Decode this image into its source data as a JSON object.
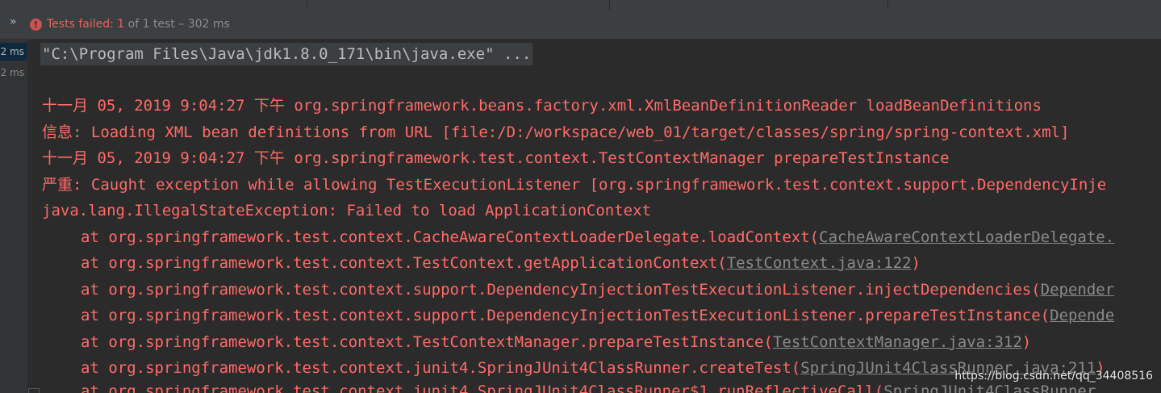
{
  "status": {
    "chevron_icon": "»",
    "error_icon": "!",
    "failed_label": "Tests failed:",
    "failed_count": "1",
    "rest_text": "of 1 test – 302 ms"
  },
  "gutter": {
    "times": [
      "2 ms",
      "2 ms"
    ]
  },
  "console": {
    "command": "\"C:\\Program Files\\Java\\jdk1.8.0_171\\bin\\java.exe\" ...",
    "lines": [
      {
        "text": "十一月 05, 2019 9:04:27 下午 org.springframework.beans.factory.xml.XmlBeanDefinitionReader loadBeanDefinitions"
      },
      {
        "text": "信息: Loading XML bean definitions from URL [file:/D:/workspace/web_01/target/classes/spring/spring-context.xml]"
      },
      {
        "text": "十一月 05, 2019 9:04:27 下午 org.springframework.test.context.TestContextManager prepareTestInstance"
      },
      {
        "text": "严重: Caught exception while allowing TestExecutionListener [org.springframework.test.context.support.DependencyInje"
      },
      {
        "text": "java.lang.IllegalStateException: Failed to load ApplicationContext"
      }
    ],
    "stack": [
      {
        "prefix": "at org.springframework.test.context.CacheAwareContextLoaderDelegate.loadContext(",
        "link": "CacheAwareContextLoaderDelegate.",
        "suffix": ""
      },
      {
        "prefix": "at org.springframework.test.context.TestContext.getApplicationContext(",
        "link": "TestContext.java:122",
        "suffix": ")"
      },
      {
        "prefix": "at org.springframework.test.context.support.DependencyInjectionTestExecutionListener.injectDependencies(",
        "link": "Depender",
        "suffix": ""
      },
      {
        "prefix": "at org.springframework.test.context.support.DependencyInjectionTestExecutionListener.prepareTestInstance(",
        "link": "Depende",
        "suffix": ""
      },
      {
        "prefix": "at org.springframework.test.context.TestContextManager.prepareTestInstance(",
        "link": "TestContextManager.java:312",
        "suffix": ")"
      },
      {
        "prefix": "at org.springframework.test.context.junit4.SpringJUnit4ClassRunner.createTest(",
        "link": "SpringJUnit4ClassRunner.java:211",
        "suffix": ")"
      },
      {
        "prefix": "at org.springframework.test.context.junit4.SpringJUnit4ClassRunner$1.runReflectiveCall(",
        "link": "SpringJUnit4ClassRunner.",
        "suffix": ""
      }
    ]
  },
  "watermark": "https://blog.csdn.net/qq_34408516",
  "colors": {
    "error": "#ff6b68",
    "background": "#2b2b2b",
    "link": "#8a8a8a"
  }
}
